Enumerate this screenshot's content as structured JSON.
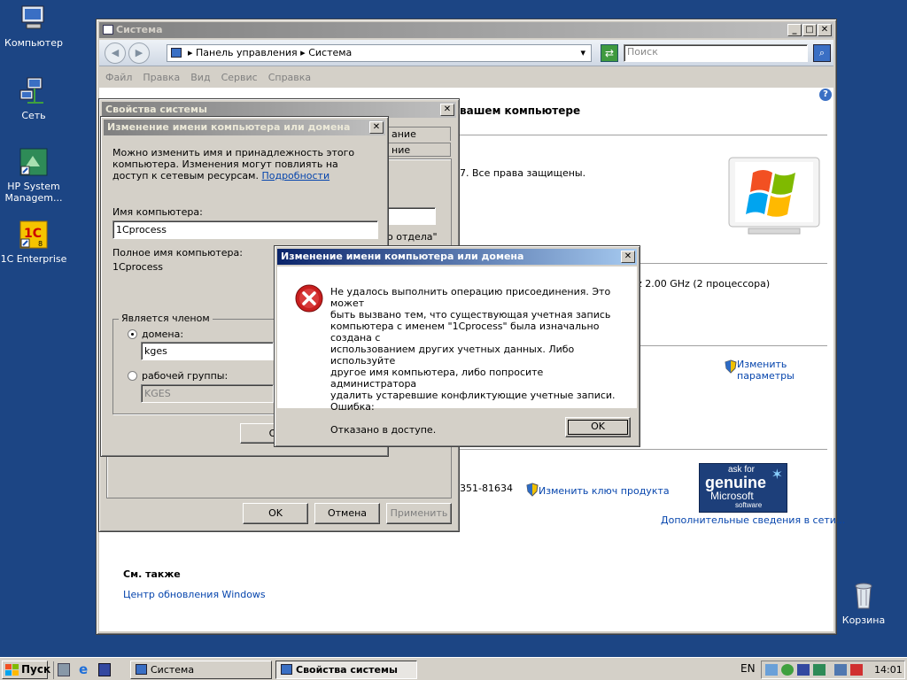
{
  "desktop": {
    "icons": [
      {
        "label": "Компьютер"
      },
      {
        "label": "Сеть"
      },
      {
        "label": "HP System Managem..."
      },
      {
        "label": "1C Enterprise"
      },
      {
        "label": "Корзина"
      }
    ]
  },
  "system_window": {
    "title": "Система",
    "address_parts": [
      "Панель управления",
      "Система"
    ],
    "search_placeholder": "Поиск",
    "menu": [
      "Файл",
      "Правка",
      "Вид",
      "Сервис",
      "Справка"
    ],
    "heading_fragment": "вашем компьютере",
    "copyright_fragment": "7.  Все права защищены.",
    "cpu_fragment": "z  2.00 GHz  (2 процессора)",
    "change_params_label": "Изменить параметры",
    "product_key_fragment": "351-81634",
    "change_key_label": "Изменить ключ продукта",
    "more_info_link": "Дополнительные сведения в сети...",
    "see_also_title": "См. также",
    "windows_update_link": "Центр обновления Windows",
    "genuine_badge": {
      "line1": "ask for",
      "line2": "genuine",
      "line3": "Microsoft",
      "line4": "software"
    }
  },
  "sysprops_dialog": {
    "title": "Свойства системы",
    "tab_fragment_1": "ание",
    "tab_fragment_2": "ние",
    "dept_fragment": "о отдела\"",
    "ok_label": "OK",
    "cancel_label": "Отмена",
    "apply_label": "Применить"
  },
  "rename_dialog": {
    "title": "Изменение имени компьютера или домена",
    "description": "Можно изменить имя и принадлежность этого компьютера. Изменения могут повлиять на доступ к сетевым ресурсам.",
    "details_link": "Подробности",
    "computer_name_label": "Имя компьютера:",
    "computer_name_value": "1Cprocess",
    "full_name_label": "Полное имя компьютера:",
    "full_name_value": "1Cprocess",
    "member_of_label": "Является членом",
    "domain_label": "домена:",
    "domain_value": "kges",
    "workgroup_label": "рабочей группы:",
    "workgroup_value": "KGES",
    "ok_fragment": "О"
  },
  "error_dialog": {
    "title": "Изменение имени компьютера или домена",
    "message_lines": [
      "Не удалось выполнить операцию присоединения. Это может",
      "быть вызвано тем, что существующая учетная запись",
      "компьютера с именем \"1Cprocess\" была изначально создана с",
      "использованием других учетных данных. Либо используйте",
      "другое имя компьютера, либо попросите администратора",
      "удалить устаревшие конфликтующие учетные записи.",
      "Ошибка:"
    ],
    "detail": "Отказано в доступе.",
    "ok_label": "OK"
  },
  "taskbar": {
    "start_label": "Пуск",
    "tasks": [
      {
        "label": "Система",
        "active": false
      },
      {
        "label": "Свойства системы",
        "active": true
      }
    ],
    "language": "EN",
    "clock": "14:01"
  },
  "colors": {
    "desktop": "#1c4584",
    "title_active": "#0a246a",
    "error_red": "#c81e1e"
  }
}
